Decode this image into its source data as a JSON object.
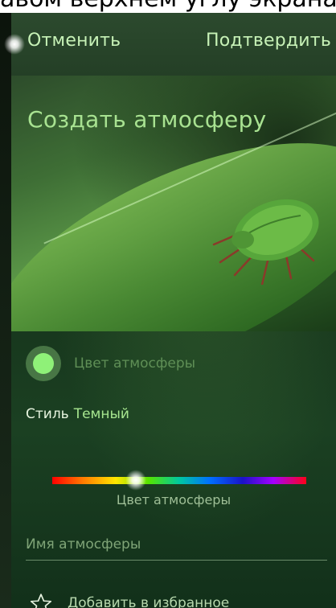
{
  "top_caption": "авом верхнем углу экрана",
  "header": {
    "cancel_label": "Отменить",
    "confirm_label": "Подтвердить"
  },
  "hero": {
    "title": "Создать атмосферу"
  },
  "ambience": {
    "color_label": "Цвет атмосферы",
    "accent_color": "#8ff178",
    "style_key": "Стиль",
    "style_value": "Темный",
    "slider_label": "Цвет атмосферы",
    "slider_value_fraction": 0.33,
    "name_placeholder": "Имя атмосферы",
    "name_value": "",
    "favorite_label": "Добавить в избранное",
    "favorite_icon": "star-outline-icon"
  }
}
